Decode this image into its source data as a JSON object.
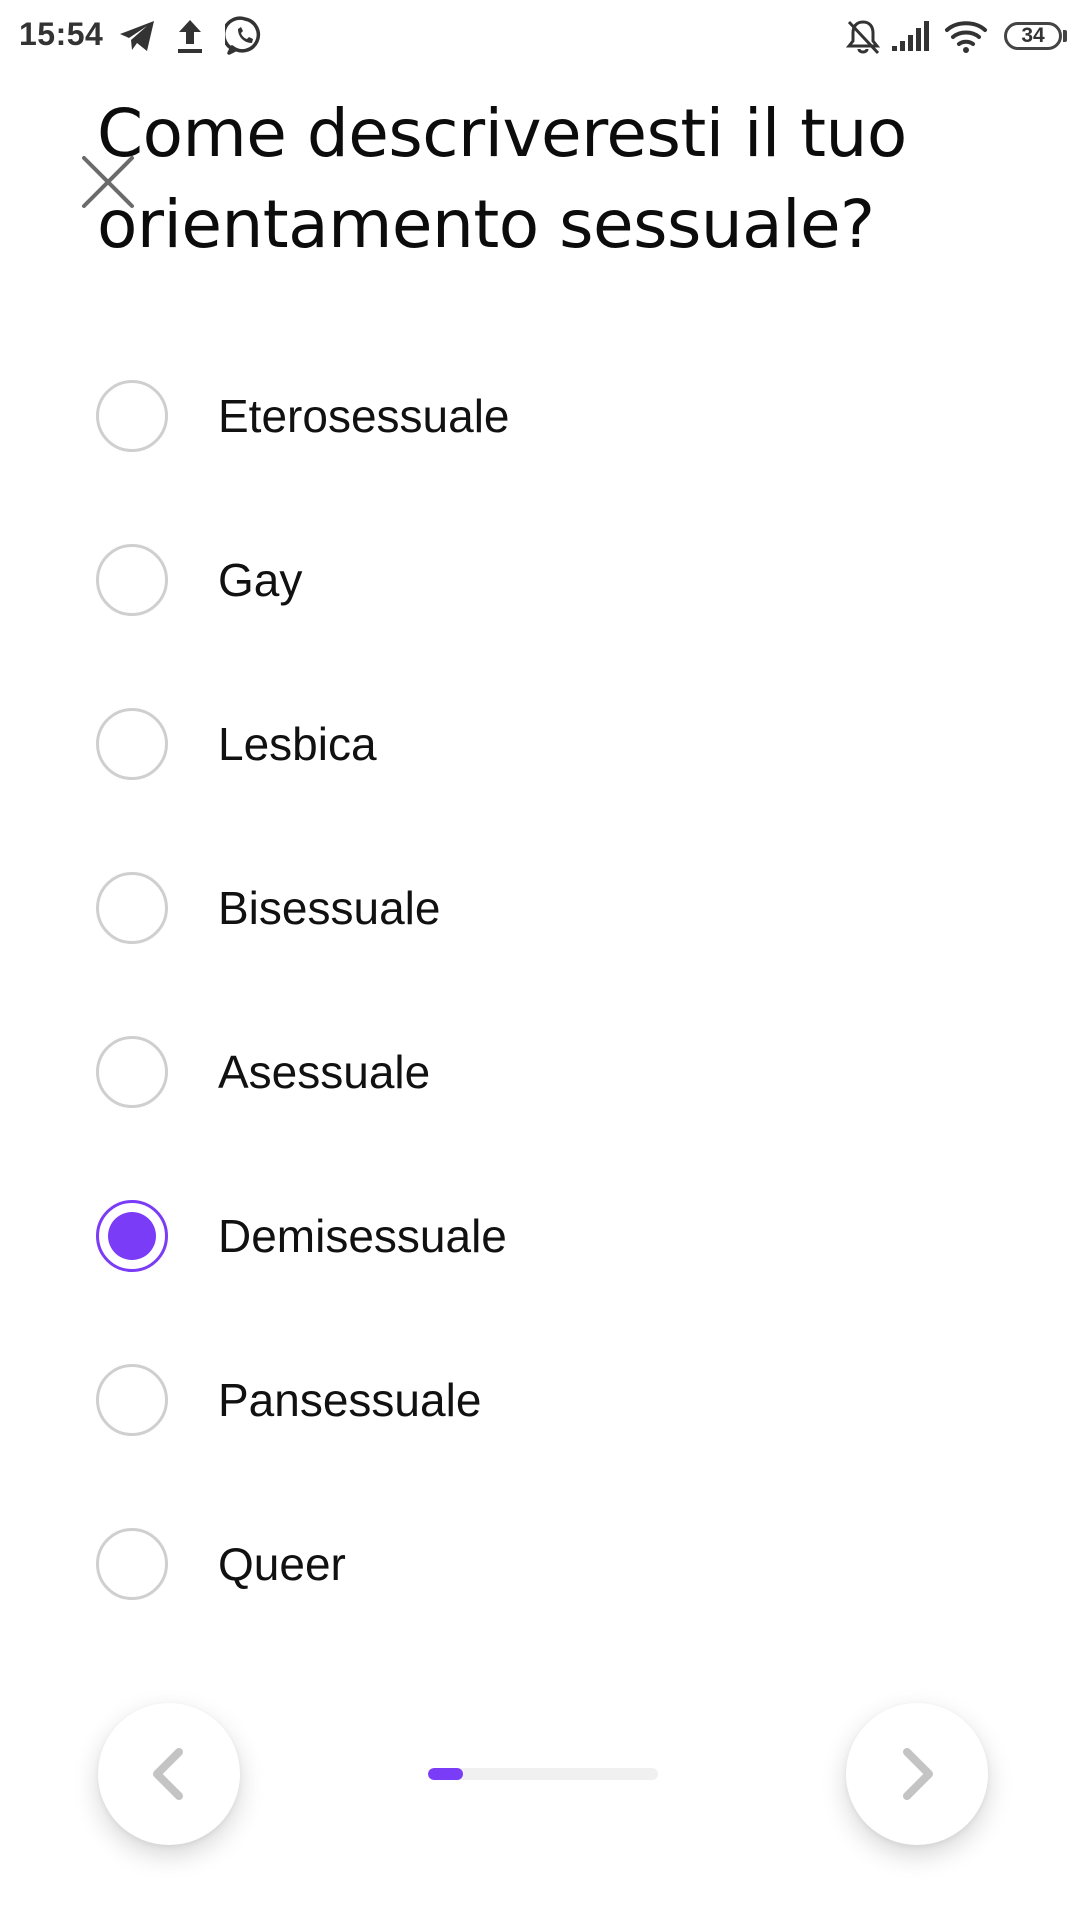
{
  "status_bar": {
    "time": "15:54",
    "battery": "34",
    "left_icons": [
      "telegram-icon",
      "upload-icon",
      "whatsapp-icon"
    ],
    "right_icons": [
      "notifications-off-icon",
      "signal-icon",
      "wifi-icon",
      "battery-icon"
    ]
  },
  "question": {
    "title": "Come descriveresti il tuo orientamento sessuale?"
  },
  "options": [
    {
      "label": "Eterosessuale",
      "selected": false
    },
    {
      "label": "Gay",
      "selected": false
    },
    {
      "label": "Lesbica",
      "selected": false
    },
    {
      "label": "Bisessuale",
      "selected": false
    },
    {
      "label": "Asessuale",
      "selected": false
    },
    {
      "label": "Demisessuale",
      "selected": true
    },
    {
      "label": "Pansessuale",
      "selected": false
    },
    {
      "label": "Queer",
      "selected": false
    }
  ],
  "navigation": {
    "back_icon": "chevron-left-icon",
    "next_icon": "chevron-right-icon",
    "progress": 0.15
  },
  "colors": {
    "accent": "#7a3cf7",
    "radio_border": "#cfcfcf",
    "nav_icon": "#c4c4c4"
  }
}
